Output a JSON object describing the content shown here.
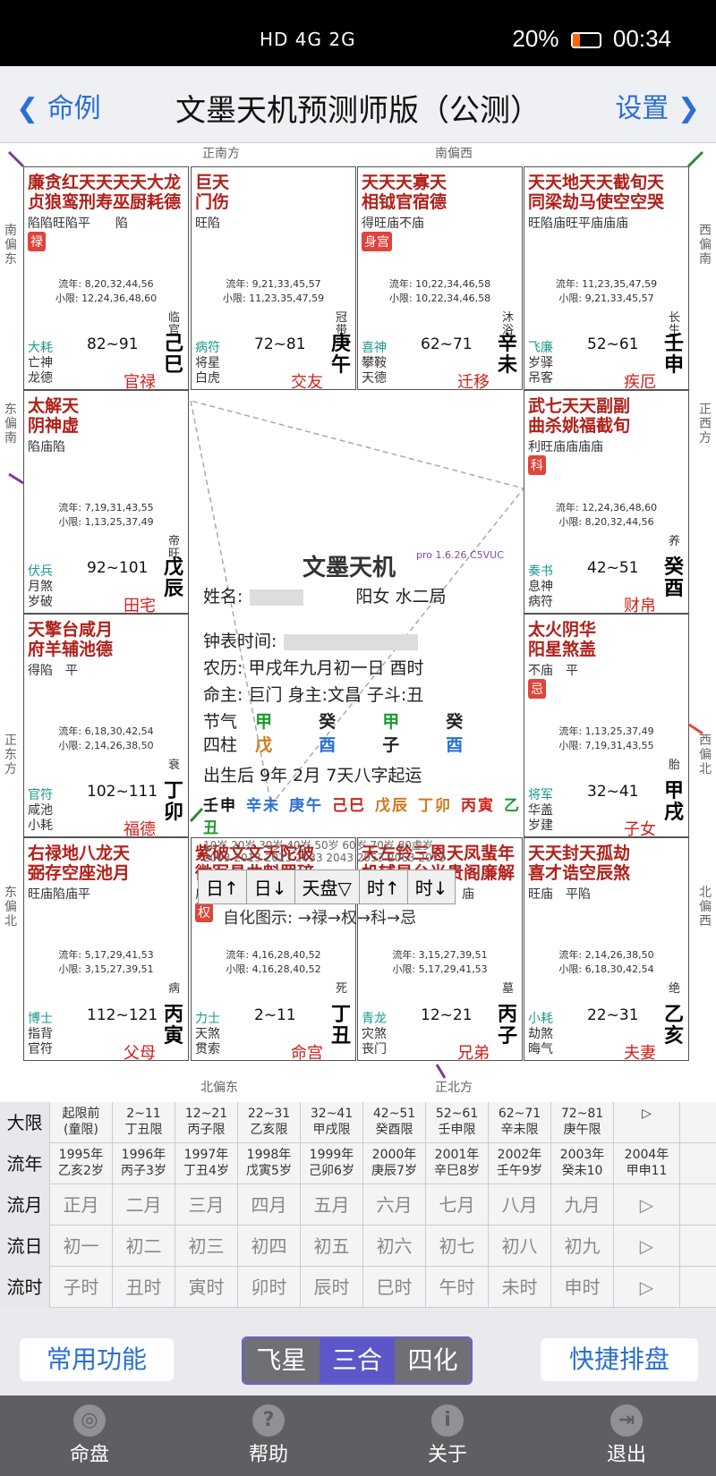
{
  "status": {
    "network": "HD 4G 2G",
    "battery": "20%",
    "time": "00:34"
  },
  "appbar": {
    "back_label": "命例",
    "title": "文墨天机预测师版（公测）",
    "settings_label": "设置"
  },
  "directions": {
    "top_left": "正南方",
    "top_right": "南偏西",
    "bottom_left": "北偏东",
    "bottom_right": "正北方",
    "left_top": "南偏东",
    "left_mid": "东偏南",
    "left_mid2": "正东方",
    "left_bottom": "东偏北",
    "right_top": "西偏南",
    "right_mid": "正西方",
    "right_mid2": "西偏北",
    "right_bottom": "北偏西"
  },
  "palaces": [
    {
      "stars": "廉贪红天天天天大龙\n贞狼鸾刑寿巫厨耗德",
      "bright": "陷陷旺陷平　　陷",
      "flow1": "流年: 8,20,32,44,56",
      "flow2": "小限: 12,24,36,48,60",
      "age": "82~91",
      "minor": [
        "大耗",
        "亡神",
        "龙德"
      ],
      "stem": "己巳",
      "pname": "官禄",
      "state": "临官",
      "badge": "禄"
    },
    {
      "stars": "巨天\n门伤",
      "bright": "旺陷",
      "flow1": "流年: 9,21,33,45,57",
      "flow2": "小限: 11,23,35,47,59",
      "age": "72~81",
      "minor": [
        "病符",
        "将星",
        "白虎"
      ],
      "stem": "庚午",
      "pname": "交友",
      "state": "冠带",
      "badge": ""
    },
    {
      "stars": "天天天寡天\n相钺官宿德",
      "bright": "得旺庙不庙",
      "flow1": "流年: 10,22,34,46,58",
      "flow2": "小限: 10,22,34,46,58",
      "age": "62~71",
      "minor": [
        "喜神",
        "攀鞍",
        "天德"
      ],
      "stem": "辛未",
      "pname": "迁移",
      "state": "沐浴",
      "badge": "身宫"
    },
    {
      "stars": "天天地天天截旬天\n同梁劫马使空空哭",
      "bright": "旺陷庙旺平庙庙庙",
      "flow1": "流年: 11,23,35,47,59",
      "flow2": "小限: 9,21,33,45,57",
      "age": "52~61",
      "minor": [
        "飞廉",
        "岁驿",
        "吊客"
      ],
      "stem": "壬申",
      "pname": "疾厄",
      "state": "长生",
      "badge": ""
    },
    {
      "stars": "太解天\n阴神虚",
      "bright": "陷庙陷",
      "flow1": "流年: 7,19,31,43,55",
      "flow2": "小限: 1,13,25,37,49",
      "age": "92~101",
      "minor": [
        "伏兵",
        "月煞",
        "岁破"
      ],
      "stem": "戊辰",
      "pname": "田宅",
      "state": "帝旺",
      "badge": ""
    },
    {
      "stars": "武七天天副副\n曲杀姚福截旬",
      "bright": "利旺庙庙庙庙",
      "flow1": "流年: 12,24,36,48,60",
      "flow2": "小限: 8,20,32,44,56",
      "age": "42~51",
      "minor": [
        "奏书",
        "息神",
        "病符"
      ],
      "stem": "癸酉",
      "pname": "财帛",
      "state": "养",
      "badge": "科"
    },
    {
      "stars": "天擎台咸月\n府羊辅池德",
      "bright": "得陷　平",
      "flow1": "流年: 6,18,30,42,54",
      "flow2": "小限: 2,14,26,38,50",
      "age": "102~111",
      "minor": [
        "官符",
        "咸池",
        "小耗"
      ],
      "stem": "丁卯",
      "pname": "福德",
      "state": "衰",
      "badge": ""
    },
    {
      "stars": "太火阴华\n阳星煞盖",
      "bright": "不庙　平",
      "flow1": "流年: 1,13,25,37,49",
      "flow2": "小限: 7,19,31,43,55",
      "age": "32~41",
      "minor": [
        "将军",
        "华盖",
        "岁建"
      ],
      "stem": "甲戌",
      "pname": "子女",
      "state": "胎",
      "badge": "忌"
    },
    {
      "stars": "右禄地八龙天\n弼存空座池月",
      "bright": "旺庙陷庙平",
      "flow1": "流年: 5,17,29,41,53",
      "flow2": "小限: 3,15,27,39,51",
      "age": "112~121",
      "minor": [
        "博士",
        "指背",
        "官符"
      ],
      "stem": "丙寅",
      "pname": "父母",
      "state": "病",
      "badge": ""
    },
    {
      "stars": "紫破文文天陀破\n微军昌曲魁罗碎",
      "bright": "庙旺庙庙旺庙陷",
      "flow1": "流年: 4,16,28,40,52",
      "flow2": "小限: 4,16,28,40,52",
      "age": "2~11",
      "minor": [
        "力士",
        "天煞",
        "贯索"
      ],
      "stem": "丁丑",
      "pname": "命宫",
      "state": "死",
      "badge": "权"
    },
    {
      "stars": "天左铃三恩天凤蜚年\n机辅星台光贵阁廉解",
      "bright": "庙旺陷平平庙庙　庙",
      "flow1": "流年: 3,15,27,39,51",
      "flow2": "小限: 5,17,29,41,53",
      "age": "12~21",
      "minor": [
        "青龙",
        "灾煞",
        "丧门"
      ],
      "stem": "丙子",
      "pname": "兄弟",
      "state": "墓",
      "badge": ""
    },
    {
      "stars": "天天封天孤劫\n喜才诰空辰煞",
      "bright": "旺庙　平陷",
      "flow1": "流年: 2,14,26,38,50",
      "flow2": "小限: 6,18,30,42,54",
      "age": "22~31",
      "minor": [
        "小耗",
        "劫煞",
        "晦气"
      ],
      "stem": "乙亥",
      "pname": "夫妻",
      "state": "绝",
      "badge": ""
    }
  ],
  "center": {
    "brand": "文墨天机",
    "version": "pro 1.6.26 C5VUC",
    "name_label": "姓名:",
    "gender": "阳女 水二局",
    "clock_label": "钟表时间:",
    "lunar": "农历: 甲戌年九月初一日 酉时",
    "master": "命主: 巨门 身主:文昌 子斗:丑",
    "jieqi_label": "节气",
    "jieqi": [
      "甲",
      "癸",
      "甲",
      "癸"
    ],
    "sizhu_label": "四柱",
    "sizhu": [
      "戊",
      "酉",
      "子",
      "酉"
    ],
    "qiyun": "出生后 9年 2月 7天八字起运",
    "dayun": [
      "壬申",
      "辛未",
      "庚午",
      "己巳",
      "戊辰",
      "丁卯",
      "丙寅",
      "乙丑"
    ],
    "ages": "10岁 20岁 30岁 40岁 50岁 60岁 70岁 80虚岁",
    "years": "2003 2013 2023 2033 2043 2053 2063 2073",
    "nav": [
      "日↑",
      "日↓",
      "天盘▽",
      "时↑",
      "时↓"
    ],
    "legend": "自化图示: →禄→权→科→忌"
  },
  "grid": {
    "daxian": {
      "label": "大限",
      "cells": [
        "起限前\n(童限)",
        "2~11\n丁丑限",
        "12~21\n丙子限",
        "22~31\n乙亥限",
        "32~41\n甲戌限",
        "42~51\n癸酉限",
        "52~61\n壬申限",
        "62~71\n辛未限",
        "72~81\n庚午限",
        "▷"
      ]
    },
    "liunian": {
      "label": "流年",
      "cells": [
        "1995年\n乙亥2岁",
        "1996年\n丙子3岁",
        "1997年\n丁丑4岁",
        "1998年\n戊寅5岁",
        "1999年\n己卯6岁",
        "2000年\n庚辰7岁",
        "2001年\n辛巳8岁",
        "2002年\n壬午9岁",
        "2003年\n癸未10",
        "2004年\n甲申11"
      ]
    },
    "liuyue": {
      "label": "流月",
      "cells": [
        "正月",
        "二月",
        "三月",
        "四月",
        "五月",
        "六月",
        "七月",
        "八月",
        "九月",
        "▷"
      ]
    },
    "liuri": {
      "label": "流日",
      "cells": [
        "初一",
        "初二",
        "初三",
        "初四",
        "初五",
        "初六",
        "初七",
        "初八",
        "初九",
        "▷"
      ]
    },
    "liushi": {
      "label": "流时",
      "cells": [
        "子时",
        "丑时",
        "寅时",
        "卯时",
        "辰时",
        "巳时",
        "午时",
        "未时",
        "申时",
        "▷"
      ]
    }
  },
  "actions": {
    "common": "常用功能",
    "seg": [
      "飞星",
      "三合",
      "四化"
    ],
    "quick": "快捷排盘"
  },
  "tabs": [
    "命盘",
    "帮助",
    "关于",
    "退出"
  ]
}
